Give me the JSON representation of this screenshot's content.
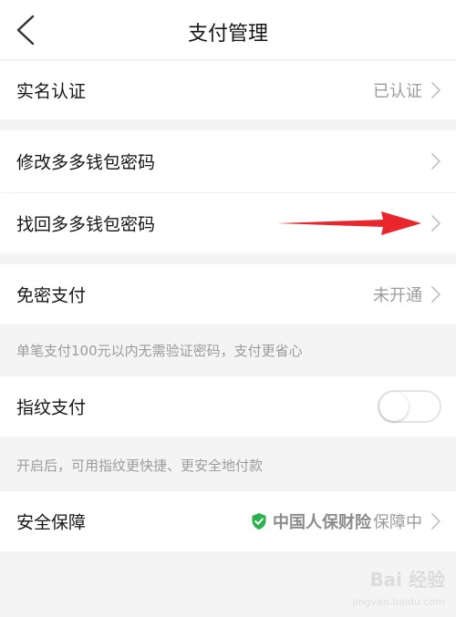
{
  "header": {
    "title": "支付管理",
    "back_icon": "chevron-left-icon"
  },
  "verification": {
    "label": "实名认证",
    "value": "已认证"
  },
  "password_section": {
    "modify_label": "修改多多钱包密码",
    "recover_label": "找回多多钱包密码"
  },
  "password_free": {
    "label": "免密支付",
    "value": "未开通",
    "note": "单笔支付100元以内无需验证密码，支付更省心"
  },
  "fingerprint": {
    "label": "指纹支付",
    "enabled": false,
    "note": "开启后，可用指纹更快捷、更安全地付款"
  },
  "security": {
    "label": "安全保障",
    "insurer": "中国人保财险",
    "status": "保障中",
    "shield_color": "#2bb24c"
  },
  "annotation": {
    "arrow_color": "#e8262b"
  },
  "watermark": {
    "text": "Bai 经验",
    "sub": "jingyan.baidu.com"
  },
  "colors": {
    "background": "#f4f4f4",
    "text": "#151516",
    "muted": "#9c9c9c"
  }
}
